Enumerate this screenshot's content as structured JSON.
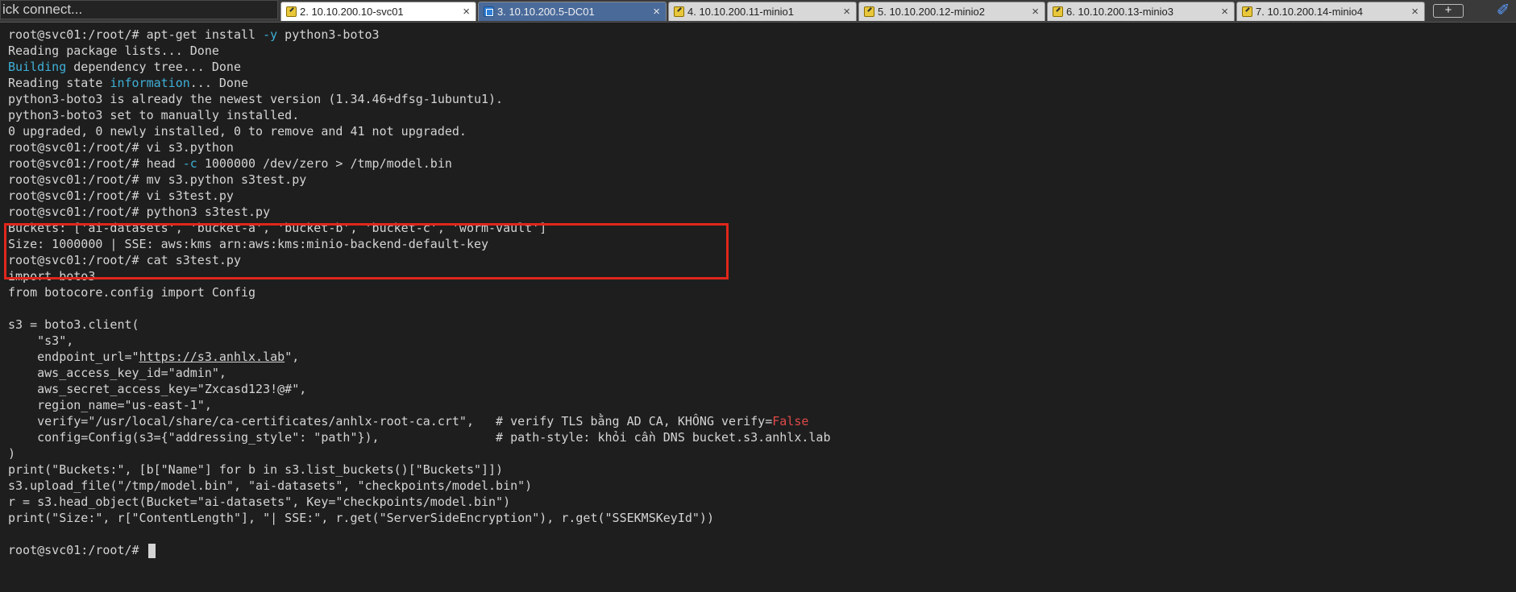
{
  "toolbar": {
    "quick_connect": "ick connect...",
    "new_tab_label": "+"
  },
  "tabs": [
    {
      "label": "2. 10.10.200.10-svc01",
      "type": "ssh",
      "active": true
    },
    {
      "label": "3. 10.10.200.5-DC01",
      "type": "rdp",
      "active": false
    },
    {
      "label": "4. 10.10.200.11-minio1",
      "type": "ssh",
      "active": false
    },
    {
      "label": "5. 10.10.200.12-minio2",
      "type": "ssh",
      "active": false
    },
    {
      "label": "6. 10.10.200.13-minio3",
      "type": "ssh",
      "active": false
    },
    {
      "label": "7. 10.10.200.14-minio4",
      "type": "ssh",
      "active": false
    }
  ],
  "tab_close_glyph": "×",
  "terminal": {
    "prompt": "root@svc01:/root/#",
    "lines": {
      "l01_cmd_a": " apt-get install ",
      "l01_flag": "-y",
      "l01_cmd_b": " python3-boto3",
      "l02": "Reading package lists... Done",
      "l03_a": "Building",
      "l03_b": " dependency tree... Done",
      "l04_a": "Reading state ",
      "l04_b": "information",
      "l04_c": "... Done",
      "l05": "python3-boto3 is already the newest version (1.34.46+dfsg-1ubuntu1).",
      "l06": "python3-boto3 set to manually installed.",
      "l07": "0 upgraded, 0 newly installed, 0 to remove and 41 not upgraded.",
      "l08_cmd": " vi s3.python",
      "l09_cmd_a": " head ",
      "l09_flag": "-c",
      "l09_cmd_b": " 1000000 /dev/zero > /tmp/model.bin",
      "l10_cmd": " mv s3.python s3test.py",
      "l11_cmd": " vi s3test.py",
      "l12_cmd": " python3 s3test.py",
      "l13": "Buckets: ['ai-datasets', 'bucket-a', 'bucket-b', 'bucket-c', 'worm-vault']",
      "l14": "Size: 1000000 | SSE: aws:kms arn:aws:kms:minio-backend-default-key",
      "l15_cmd": " cat s3test.py",
      "l16": "import boto3",
      "l17": "from botocore.config import Config",
      "l18": "",
      "l19": "s3 = boto3.client(",
      "l20": "    \"s3\",",
      "l21_a": "    endpoint_url=\"",
      "l21_url": "https://s3.anhlx.lab",
      "l21_b": "\",",
      "l22": "    aws_access_key_id=\"admin\",",
      "l23": "    aws_secret_access_key=\"Zxcasd123!@#\",",
      "l24": "    region_name=\"us-east-1\",",
      "l25_a": "    verify=\"/usr/local/share/ca-certificates/anhlx-root-ca.crt\",   # verify TLS bằng AD CA, KHÔNG verify=",
      "l25_b": "False",
      "l26": "    config=Config(s3={\"addressing_style\": \"path\"}),                # path-style: khỏi cần DNS bucket.s3.anhlx.lab",
      "l27": ")",
      "l28": "print(\"Buckets:\", [b[\"Name\"] for b in s3.list_buckets()[\"Buckets\"]])",
      "l29": "s3.upload_file(\"/tmp/model.bin\", \"ai-datasets\", \"checkpoints/model.bin\")",
      "l30": "r = s3.head_object(Bucket=\"ai-datasets\", Key=\"checkpoints/model.bin\")",
      "l31": "print(\"Size:\", r[\"ContentLength\"], \"| SSE:\", r.get(\"ServerSideEncryption\"), r.get(\"SSEKMSKeyId\"))"
    }
  },
  "colors": {
    "background": "#1e1e1e",
    "text": "#d4d4d4",
    "cyan": "#3fb0d8",
    "red": "#e04a4a",
    "highlight_border": "#e0261b"
  }
}
